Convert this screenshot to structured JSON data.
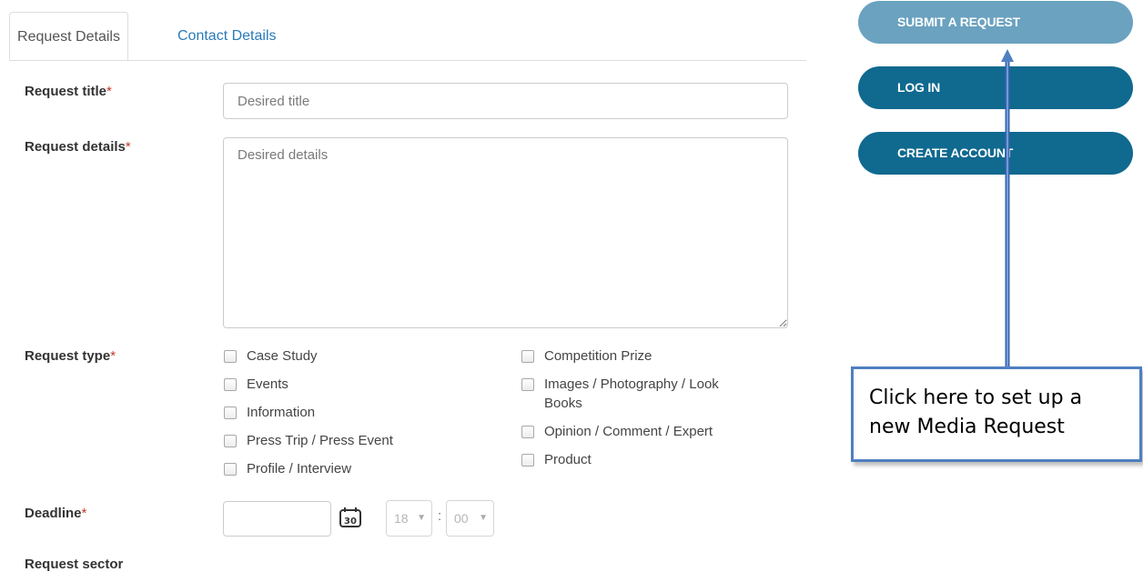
{
  "tabs": [
    {
      "label": "Request Details",
      "active": true
    },
    {
      "label": "Contact Details",
      "active": false
    }
  ],
  "form": {
    "title": {
      "label": "Request title",
      "required_mark": "*",
      "placeholder": "Desired title"
    },
    "details": {
      "label": "Request details",
      "required_mark": "*",
      "placeholder": "Desired details"
    },
    "type": {
      "label": "Request type",
      "required_mark": "*",
      "options_left": [
        "Case Study",
        "Events",
        "Information",
        "Press Trip / Press Event",
        "Profile / Interview"
      ],
      "options_right": [
        "Competition Prize",
        "Images / Photography / Look Books",
        "Opinion / Comment / Expert",
        "Product"
      ]
    },
    "deadline": {
      "label": "Deadline",
      "required_mark": "*",
      "calendar_day": "30",
      "hour": "18",
      "minute": "00",
      "separator": ":"
    },
    "sector": {
      "label": "Request sector"
    }
  },
  "buttons": {
    "submit": "SUBMIT A REQUEST",
    "login": "LOG IN",
    "create": "CREATE ACCOUNT"
  },
  "annotation": {
    "line1": "Click here to set up a",
    "line2": "new Media Request"
  },
  "colors": {
    "submit": "#6aa2c0",
    "primary": "#10698f",
    "link": "#2a7ab8",
    "required": "#c0392b",
    "annotation": "#4f7fc0"
  }
}
